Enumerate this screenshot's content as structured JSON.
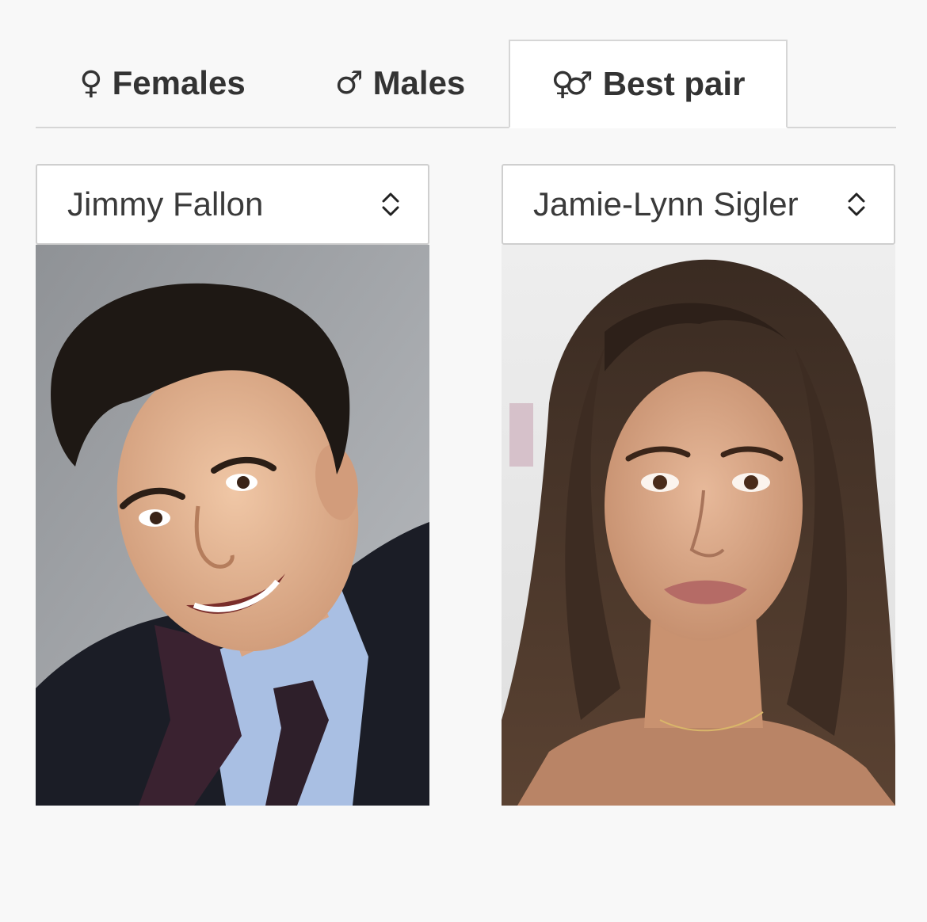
{
  "tabs": [
    {
      "id": "females",
      "icon": "female-symbol-icon",
      "glyph": "♀",
      "label": "Females",
      "active": false
    },
    {
      "id": "males",
      "icon": "male-symbol-icon",
      "glyph": "♂",
      "label": "Males",
      "active": false
    },
    {
      "id": "best_pair",
      "icon": "pair-symbol-icon",
      "glyph": "♀♂",
      "label": "Best pair",
      "active": true
    }
  ],
  "left": {
    "selected": "Jimmy Fallon",
    "photo_icon": "male-portrait-photo"
  },
  "right": {
    "selected": "Jamie-Lynn Sigler",
    "photo_icon": "female-portrait-photo"
  },
  "colors": {
    "page_bg": "#f8f8f8",
    "tab_text": "#333333",
    "border": "#d6d6d6"
  }
}
